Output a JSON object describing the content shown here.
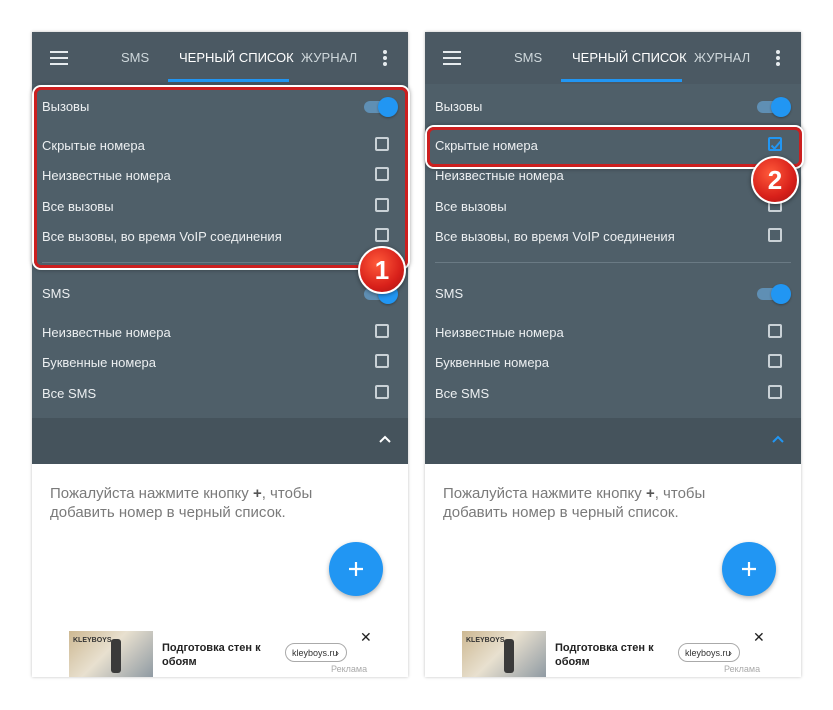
{
  "tabs": {
    "sms": "SMS",
    "blacklist": "ЧЕРНЫЙ СПИСОК",
    "journal": "ЖУРНАЛ"
  },
  "calls": {
    "title": "Вызовы",
    "enabled": true,
    "items": [
      {
        "label": "Скрытые номера"
      },
      {
        "label": "Неизвестные номера"
      },
      {
        "label": "Все вызовы"
      },
      {
        "label": "Все вызовы, во время VoIP соединения"
      }
    ]
  },
  "sms": {
    "title": "SMS",
    "enabled": true,
    "items": [
      {
        "label": "Неизвестные номера"
      },
      {
        "label": "Буквенные номера"
      },
      {
        "label": "Все SMS"
      }
    ]
  },
  "screens": [
    {
      "hidden_numbers_checked": false,
      "step_badge": "1"
    },
    {
      "hidden_numbers_checked": true,
      "step_badge": "2"
    }
  ],
  "hint": {
    "before": "Пожалуйста нажмите кнопку ",
    "plus": "+",
    "after": ", чтобы добавить номер в черный список."
  },
  "ad": {
    "title": "Подготовка стен к обоям",
    "domain": "kleyboys.ru",
    "arrow": "›",
    "label": "Реклама",
    "close": "✕",
    "logo": "KLEYBOYS"
  },
  "icons": {
    "menu": "hamburger-icon",
    "more": "more-vert-icon",
    "collapse": "chevron-up-icon",
    "add": "plus-icon",
    "check": "check-icon"
  },
  "colors": {
    "accent": "#2196f3",
    "toolbar": "#4b5963",
    "panel": "#4f5f69",
    "highlight": "#cc1f1f"
  }
}
